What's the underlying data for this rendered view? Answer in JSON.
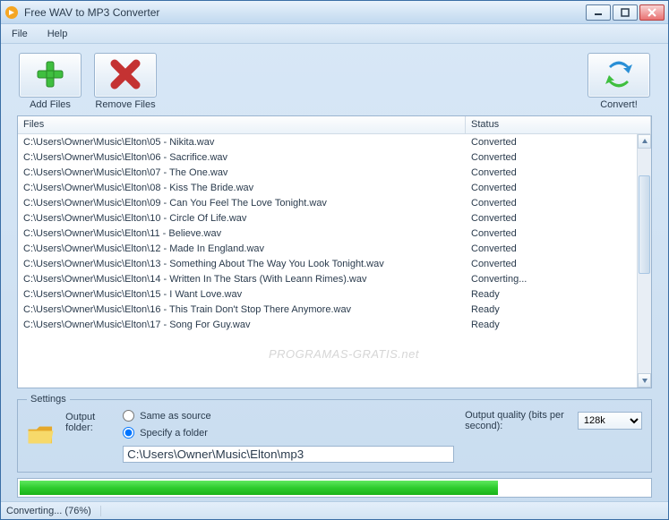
{
  "window": {
    "title": "Free WAV to MP3 Converter"
  },
  "menu": {
    "file": "File",
    "help": "Help"
  },
  "toolbar": {
    "add_label": "Add Files",
    "remove_label": "Remove Files",
    "convert_label": "Convert!"
  },
  "list": {
    "header_files": "Files",
    "header_status": "Status",
    "rows": [
      {
        "file": "C:\\Users\\Owner\\Music\\Elton\\05 - Nikita.wav",
        "status": "Converted"
      },
      {
        "file": "C:\\Users\\Owner\\Music\\Elton\\06 - Sacrifice.wav",
        "status": "Converted"
      },
      {
        "file": "C:\\Users\\Owner\\Music\\Elton\\07 - The One.wav",
        "status": "Converted"
      },
      {
        "file": "C:\\Users\\Owner\\Music\\Elton\\08 - Kiss The Bride.wav",
        "status": "Converted"
      },
      {
        "file": "C:\\Users\\Owner\\Music\\Elton\\09 - Can You Feel The Love Tonight.wav",
        "status": "Converted"
      },
      {
        "file": "C:\\Users\\Owner\\Music\\Elton\\10 - Circle Of Life.wav",
        "status": "Converted"
      },
      {
        "file": "C:\\Users\\Owner\\Music\\Elton\\11 - Believe.wav",
        "status": "Converted"
      },
      {
        "file": "C:\\Users\\Owner\\Music\\Elton\\12 - Made In England.wav",
        "status": "Converted"
      },
      {
        "file": "C:\\Users\\Owner\\Music\\Elton\\13 - Something About The Way You Look Tonight.wav",
        "status": "Converted"
      },
      {
        "file": "C:\\Users\\Owner\\Music\\Elton\\14 - Written In The Stars (With Leann Rimes).wav",
        "status": "Converting..."
      },
      {
        "file": "C:\\Users\\Owner\\Music\\Elton\\15 - I Want Love.wav",
        "status": "Ready"
      },
      {
        "file": "C:\\Users\\Owner\\Music\\Elton\\16 - This Train Don't Stop There Anymore.wav",
        "status": "Ready"
      },
      {
        "file": "C:\\Users\\Owner\\Music\\Elton\\17 - Song For Guy.wav",
        "status": "Ready"
      }
    ]
  },
  "settings": {
    "legend": "Settings",
    "output_folder_label": "Output folder:",
    "same_as_source": "Same as source",
    "specify_folder": "Specify a folder",
    "folder_path": "C:\\Users\\Owner\\Music\\Elton\\mp3",
    "output_quality_label": "Output quality (bits per second):",
    "quality_value": "128k",
    "selected_option": "specify"
  },
  "progress": {
    "percent": 76
  },
  "status": {
    "text": "Converting... (76%)"
  },
  "watermark": "PROGRAMAS-GRATIS.net"
}
